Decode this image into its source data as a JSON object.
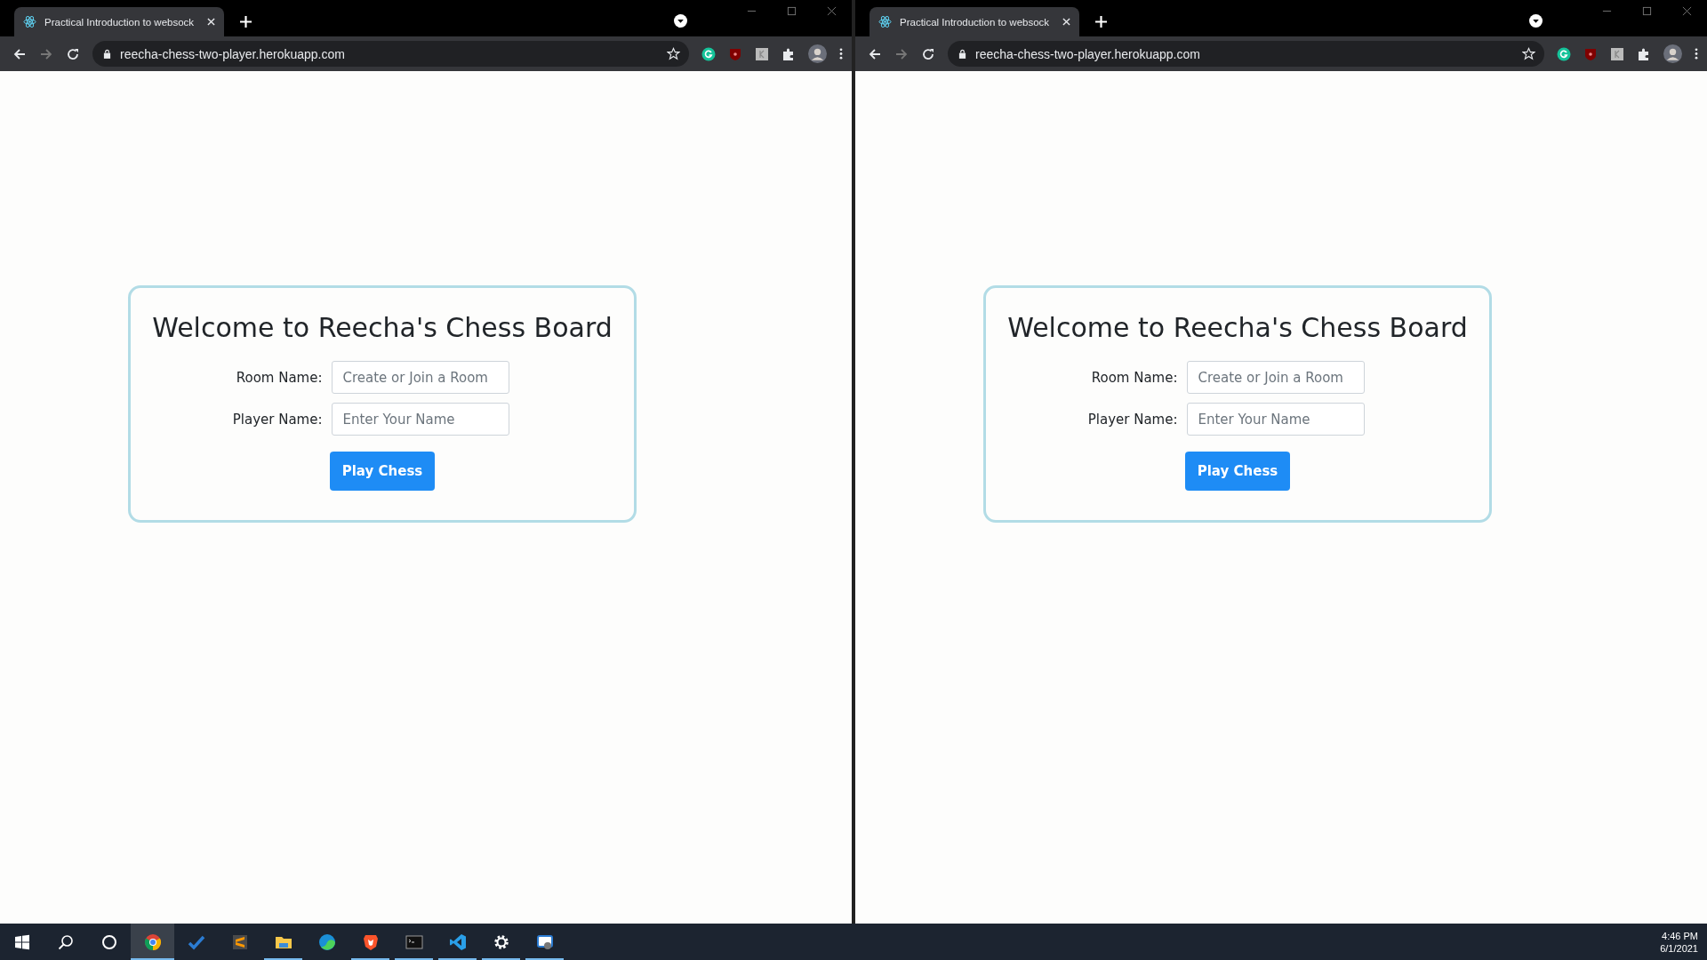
{
  "windows": [
    {
      "tab_title": "Practical Introduction to websock",
      "url": "reecha-chess-two-player.herokuapp.com",
      "page": {
        "title": "Welcome to Reecha's Chess Board",
        "fields": [
          {
            "label": "Room Name:",
            "placeholder": "Create or Join a Room"
          },
          {
            "label": "Player Name:",
            "placeholder": "Enter Your Name"
          }
        ],
        "button": "Play Chess"
      }
    },
    {
      "tab_title": "Practical Introduction to websock",
      "url": "reecha-chess-two-player.herokuapp.com",
      "page": {
        "title": "Welcome to Reecha's Chess Board",
        "fields": [
          {
            "label": "Room Name:",
            "placeholder": "Create or Join a Room"
          },
          {
            "label": "Player Name:",
            "placeholder": "Enter Your Name"
          }
        ],
        "button": "Play Chess"
      }
    }
  ],
  "taskbar": {
    "apps": [
      {
        "kind": "start",
        "running": false,
        "selected": false
      },
      {
        "kind": "search",
        "running": false,
        "selected": false
      },
      {
        "kind": "cortana",
        "running": false,
        "selected": false
      },
      {
        "kind": "chrome",
        "running": true,
        "selected": true
      },
      {
        "kind": "todo",
        "running": false,
        "selected": false
      },
      {
        "kind": "sublime",
        "running": false,
        "selected": false
      },
      {
        "kind": "explorer",
        "running": true,
        "selected": false
      },
      {
        "kind": "edge",
        "running": false,
        "selected": false
      },
      {
        "kind": "brave",
        "running": true,
        "selected": false
      },
      {
        "kind": "terminal",
        "running": true,
        "selected": false
      },
      {
        "kind": "vscode",
        "running": true,
        "selected": false
      },
      {
        "kind": "settings",
        "running": true,
        "selected": false
      },
      {
        "kind": "snip",
        "running": true,
        "selected": false
      }
    ],
    "time": "4:46 PM",
    "date": "6/1/2021"
  }
}
